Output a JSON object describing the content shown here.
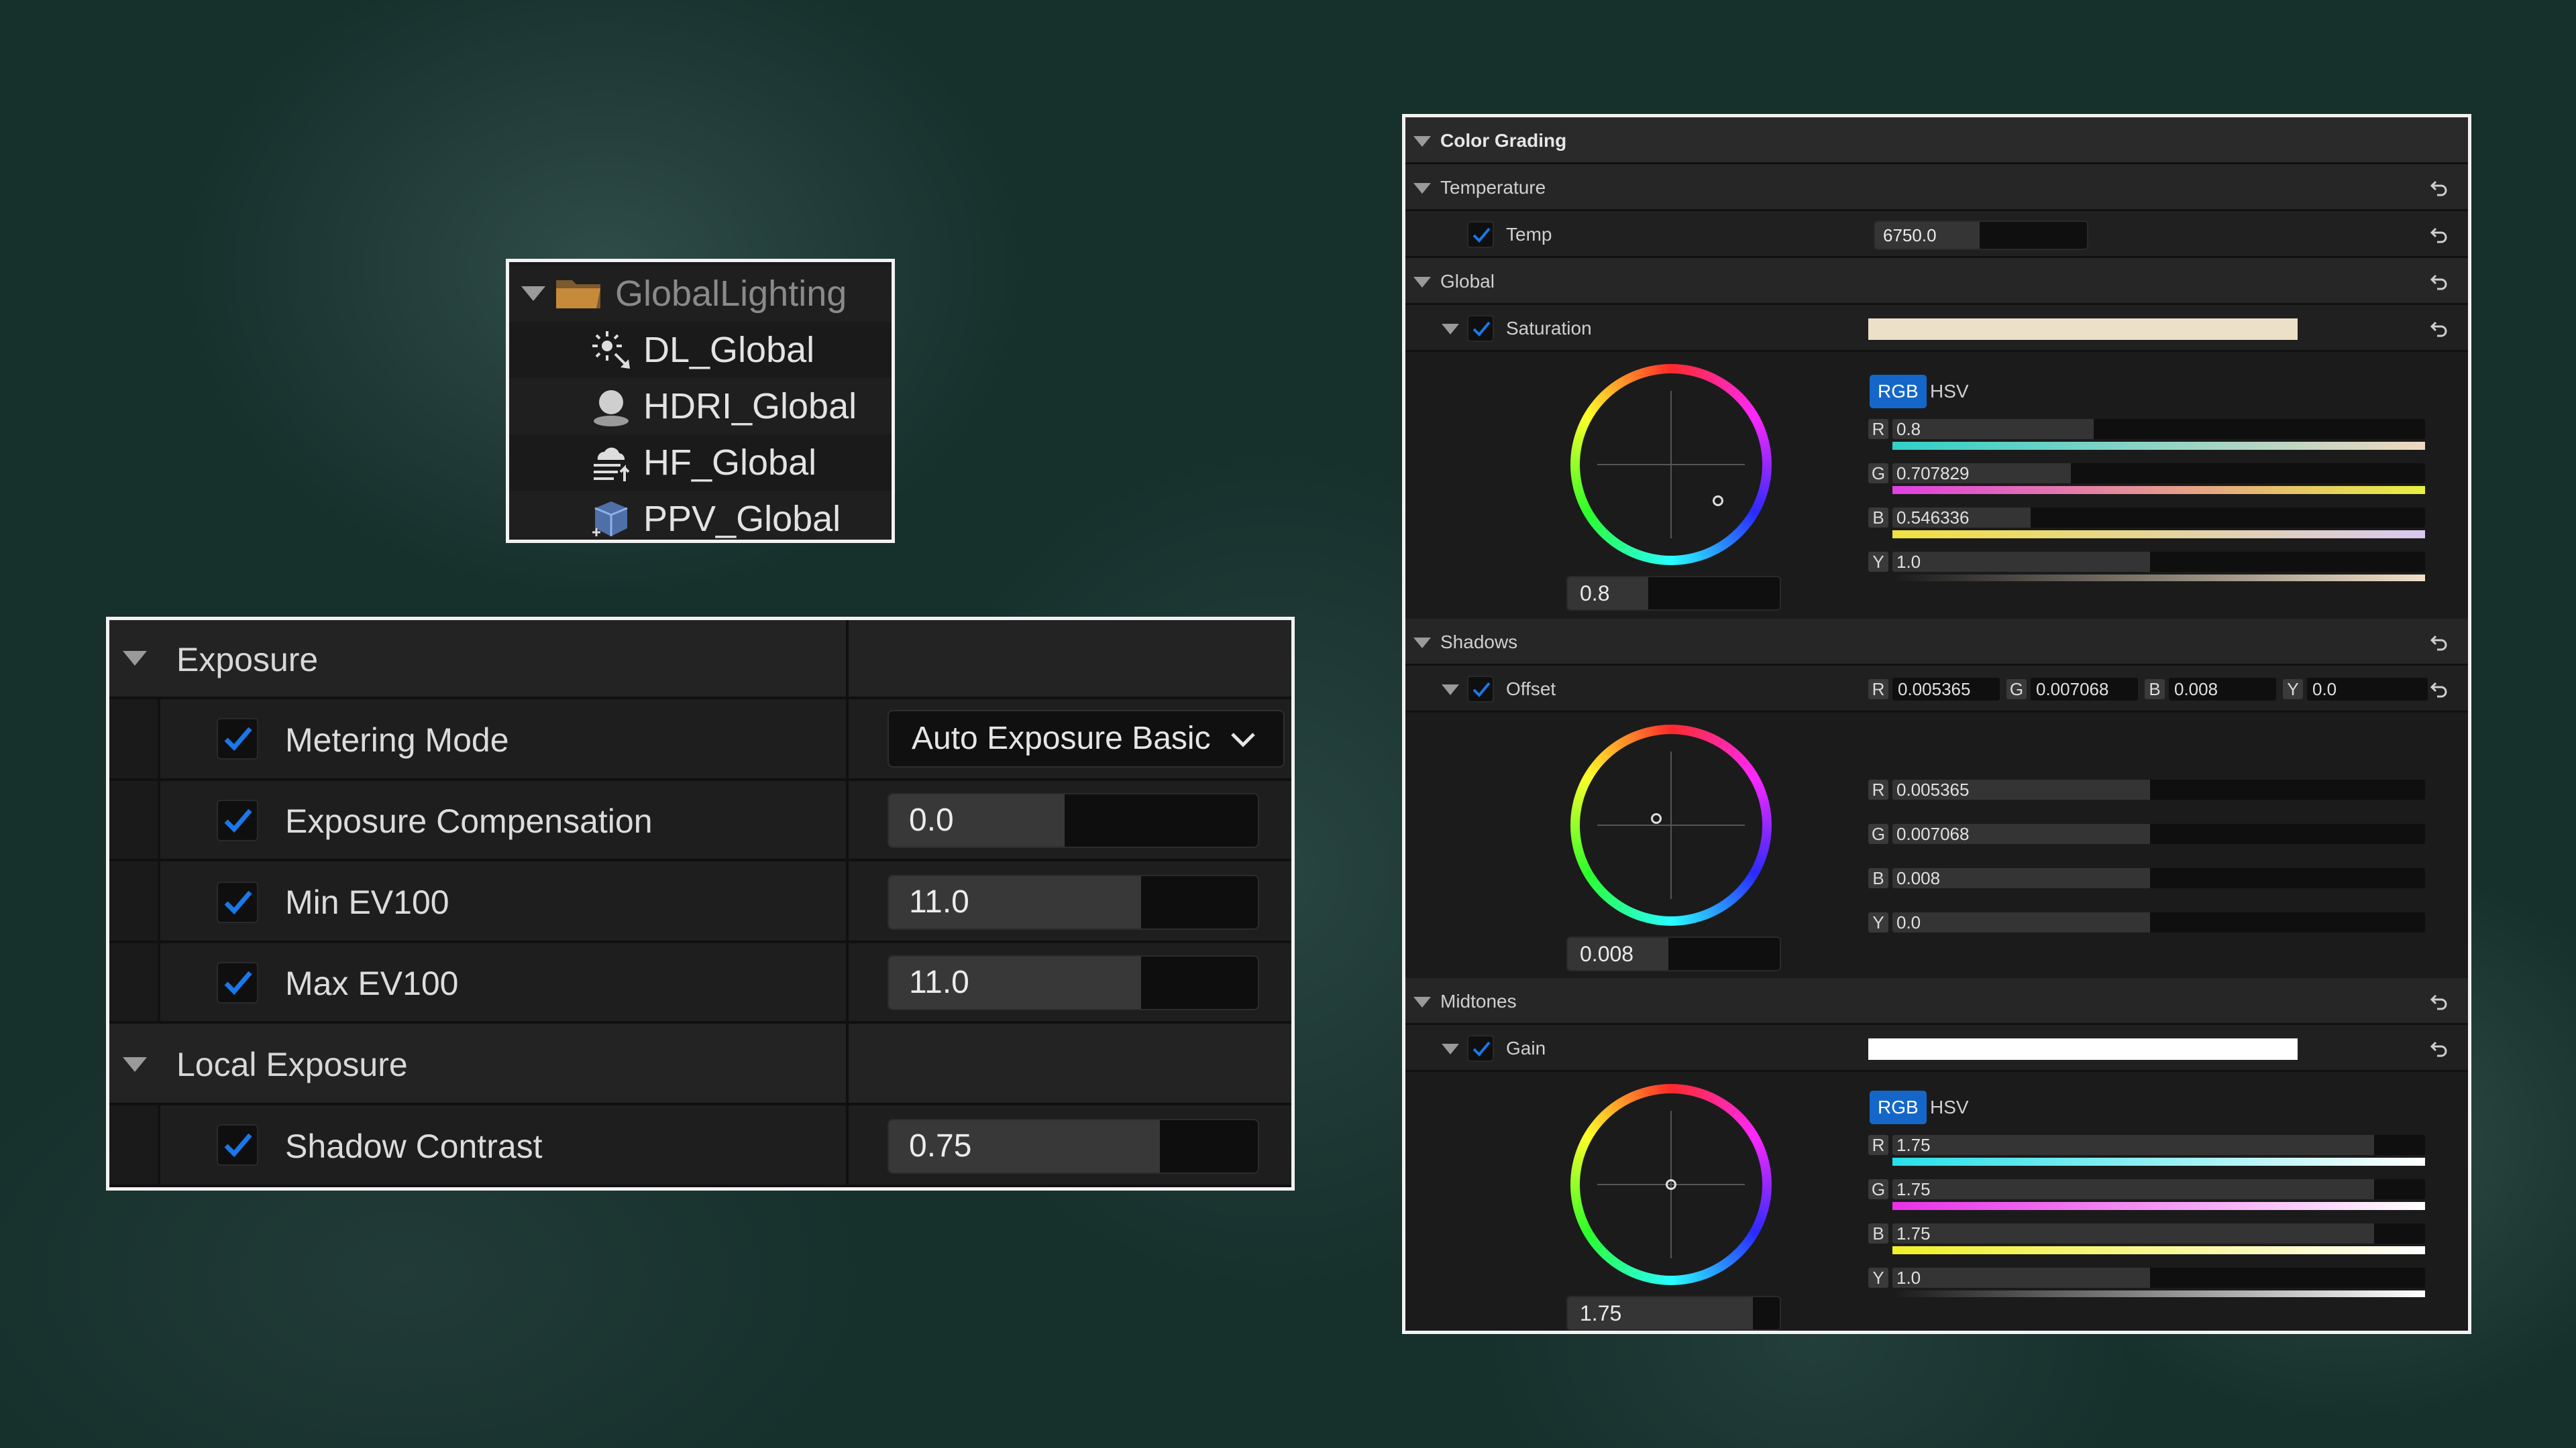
{
  "outliner": {
    "folder": "GlobalLighting",
    "items": [
      {
        "label": "DL_Global",
        "icon": "directional-light-icon"
      },
      {
        "label": "HDRI_Global",
        "icon": "hdri-backdrop-icon"
      },
      {
        "label": "HF_Global",
        "icon": "height-fog-icon"
      },
      {
        "label": "PPV_Global",
        "icon": "post-process-volume-icon"
      }
    ]
  },
  "exposure": {
    "category": "Exposure",
    "metering_mode": {
      "label": "Metering Mode",
      "value": "Auto Exposure Basic"
    },
    "exposure_compensation": {
      "label": "Exposure Compensation",
      "value": "0.0"
    },
    "min_ev100": {
      "label": "Min EV100",
      "value": "11.0"
    },
    "max_ev100": {
      "label": "Max EV100",
      "value": "11.0"
    },
    "local_category": "Local Exposure",
    "shadow_contrast": {
      "label": "Shadow Contrast",
      "value": "0.75"
    }
  },
  "color_grading": {
    "title": "Color Grading",
    "temperature": {
      "label": "Temperature",
      "temp_label": "Temp",
      "temp_value": "6750.0"
    },
    "global": {
      "label": "Global",
      "saturation_label": "Saturation",
      "saturation_color": "#ede0c8",
      "wheel_value": "0.8",
      "mode_rgb": "RGB",
      "mode_hsv": "HSV",
      "r": "0.8",
      "g": "0.707829",
      "b": "0.546336",
      "y": "1.0"
    },
    "shadows": {
      "label": "Shadows",
      "offset_label": "Offset",
      "inline": {
        "r": "0.005365",
        "g": "0.007068",
        "b": "0.008",
        "y": "0.0"
      },
      "wheel_value": "0.008",
      "r": "0.005365",
      "g": "0.007068",
      "b": "0.008",
      "y": "0.0"
    },
    "midtones": {
      "label": "Midtones",
      "gain_label": "Gain",
      "gain_color": "#ffffff",
      "wheel_value": "1.75",
      "mode_rgb": "RGB",
      "mode_hsv": "HSV",
      "r": "1.75",
      "g": "1.75",
      "b": "1.75",
      "y": "1.0"
    },
    "channel_letters": {
      "r": "R",
      "g": "G",
      "b": "B",
      "y": "Y"
    }
  }
}
